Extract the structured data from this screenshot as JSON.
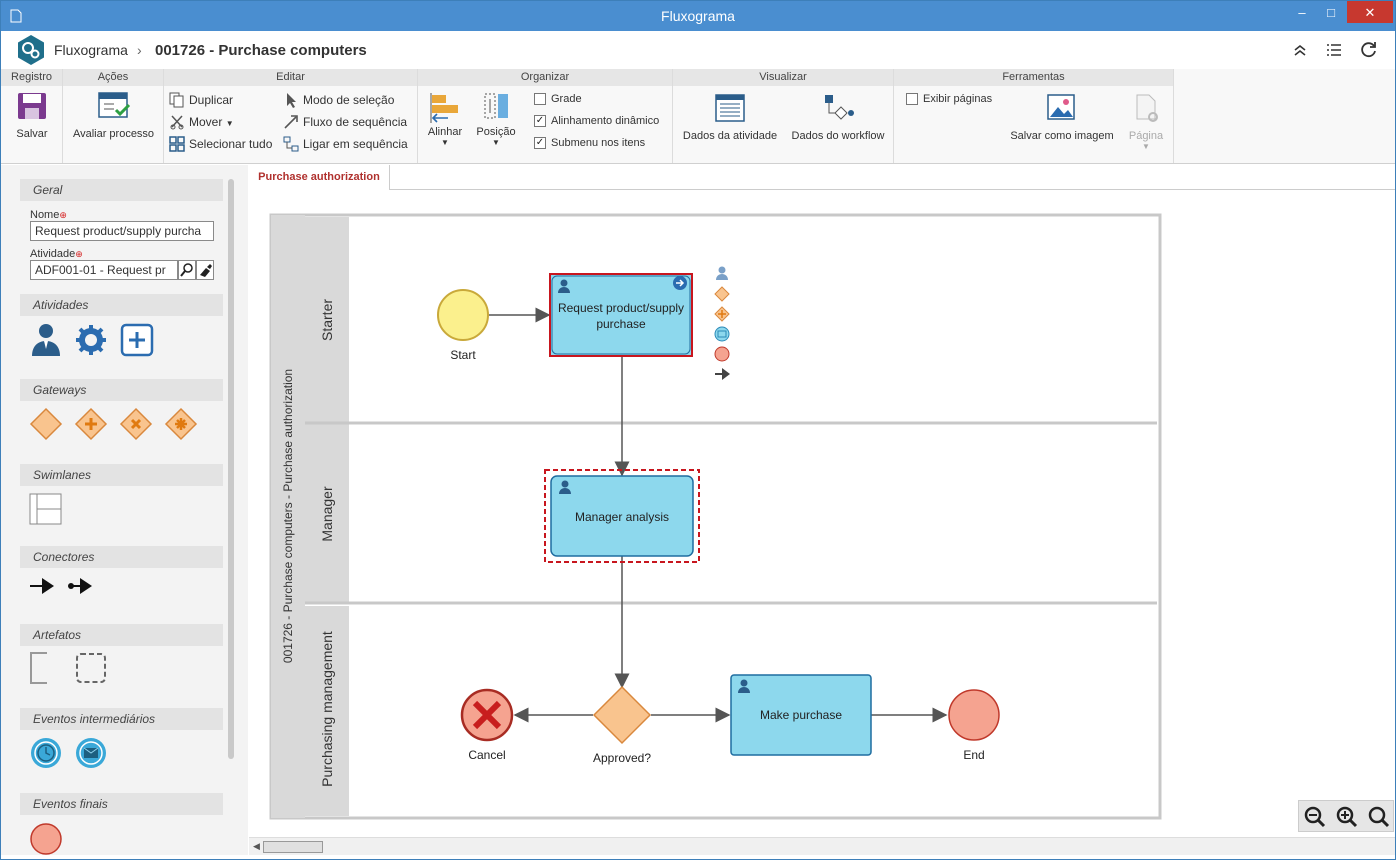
{
  "window": {
    "title": "Fluxograma",
    "minimize": "–",
    "maximize": "□",
    "close": "✕"
  },
  "header": {
    "app_name": "Fluxograma",
    "separator": "›",
    "document_title": "001726 - Purchase computers"
  },
  "ribbon": {
    "groups": {
      "registro": "Registro",
      "acoes": "Ações",
      "editar": "Editar",
      "organizar": "Organizar",
      "visualizar": "Visualizar",
      "ferramentas": "Ferramentas"
    },
    "salvar": "Salvar",
    "avaliar_processo": "Avaliar processo",
    "duplicar": "Duplicar",
    "mover": "Mover",
    "selecionar_tudo": "Selecionar tudo",
    "modo_selecao": "Modo de seleção",
    "fluxo_sequencia": "Fluxo de sequência",
    "ligar_sequencia": "Ligar em sequência",
    "alinhar": "Alinhar",
    "posicao": "Posição",
    "grade": "Grade",
    "alinhamento_dinamico": "Alinhamento dinâmico",
    "submenu_itens": "Submenu nos itens",
    "dados_atividade": "Dados da atividade",
    "dados_workflow": "Dados do workflow",
    "exibir_paginas": "Exibir páginas",
    "salvar_imagem": "Salvar como imagem",
    "pagina": "Página",
    "checks": {
      "grade": "",
      "alinhamento_dinamico": "✓",
      "submenu_itens": "✓",
      "exibir_paginas": ""
    }
  },
  "panel": {
    "geral": "Geral",
    "nome_label": "Nome",
    "nome_value": "Request product/supply purcha",
    "atividade_label": "Atividade",
    "atividade_value": "ADF001-01 - Request pr",
    "atividades": "Atividades",
    "gateways": "Gateways",
    "swimlanes": "Swimlanes",
    "conectores": "Conectores",
    "artefatos": "Artefatos",
    "eventos_intermediarios": "Eventos intermediários",
    "eventos_finais": "Eventos finais"
  },
  "tab": {
    "label": "Purchase authorization"
  },
  "diagram": {
    "pool_label": "001726 - Purchase computers - Purchase authorization",
    "lanes": [
      "Starter",
      "Manager",
      "Purchasing management"
    ],
    "start_label": "Start",
    "task1": "Request product/supply purchase",
    "task2": "Manager analysis",
    "task3": "Make purchase",
    "gateway_label": "Approved?",
    "cancel_label": "Cancel",
    "end_label": "End"
  },
  "colors": {
    "task_fill": "#8dd8ed",
    "task_border": "#1f6da0",
    "start_fill": "#fbf08d",
    "end_fill": "#f5a390",
    "gateway_fill": "#f9c48e",
    "selected_border": "#c8161e",
    "titlebar": "#4a8ed0"
  }
}
